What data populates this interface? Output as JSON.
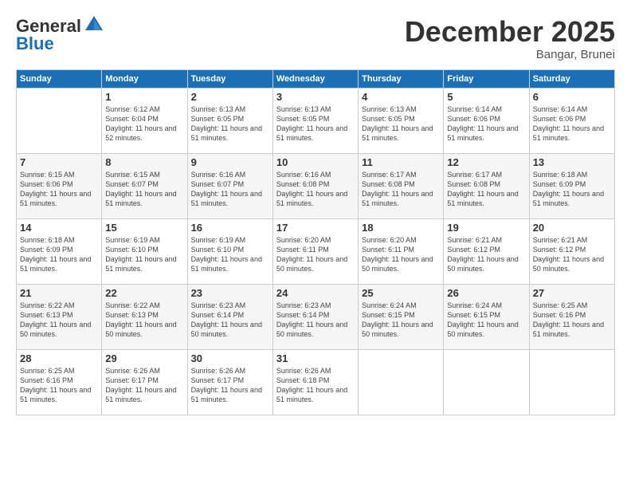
{
  "header": {
    "logo_line1": "General",
    "logo_line2": "Blue",
    "month_title": "December 2025",
    "location": "Bangar, Brunei"
  },
  "weekdays": [
    "Sunday",
    "Monday",
    "Tuesday",
    "Wednesday",
    "Thursday",
    "Friday",
    "Saturday"
  ],
  "weeks": [
    [
      {
        "day": "",
        "sunrise": "",
        "sunset": "",
        "daylight": ""
      },
      {
        "day": "1",
        "sunrise": "Sunrise: 6:12 AM",
        "sunset": "Sunset: 6:04 PM",
        "daylight": "Daylight: 11 hours and 52 minutes."
      },
      {
        "day": "2",
        "sunrise": "Sunrise: 6:13 AM",
        "sunset": "Sunset: 6:05 PM",
        "daylight": "Daylight: 11 hours and 51 minutes."
      },
      {
        "day": "3",
        "sunrise": "Sunrise: 6:13 AM",
        "sunset": "Sunset: 6:05 PM",
        "daylight": "Daylight: 11 hours and 51 minutes."
      },
      {
        "day": "4",
        "sunrise": "Sunrise: 6:13 AM",
        "sunset": "Sunset: 6:05 PM",
        "daylight": "Daylight: 11 hours and 51 minutes."
      },
      {
        "day": "5",
        "sunrise": "Sunrise: 6:14 AM",
        "sunset": "Sunset: 6:06 PM",
        "daylight": "Daylight: 11 hours and 51 minutes."
      },
      {
        "day": "6",
        "sunrise": "Sunrise: 6:14 AM",
        "sunset": "Sunset: 6:06 PM",
        "daylight": "Daylight: 11 hours and 51 minutes."
      }
    ],
    [
      {
        "day": "7",
        "sunrise": "Sunrise: 6:15 AM",
        "sunset": "Sunset: 6:06 PM",
        "daylight": "Daylight: 11 hours and 51 minutes."
      },
      {
        "day": "8",
        "sunrise": "Sunrise: 6:15 AM",
        "sunset": "Sunset: 6:07 PM",
        "daylight": "Daylight: 11 hours and 51 minutes."
      },
      {
        "day": "9",
        "sunrise": "Sunrise: 6:16 AM",
        "sunset": "Sunset: 6:07 PM",
        "daylight": "Daylight: 11 hours and 51 minutes."
      },
      {
        "day": "10",
        "sunrise": "Sunrise: 6:16 AM",
        "sunset": "Sunset: 6:08 PM",
        "daylight": "Daylight: 11 hours and 51 minutes."
      },
      {
        "day": "11",
        "sunrise": "Sunrise: 6:17 AM",
        "sunset": "Sunset: 6:08 PM",
        "daylight": "Daylight: 11 hours and 51 minutes."
      },
      {
        "day": "12",
        "sunrise": "Sunrise: 6:17 AM",
        "sunset": "Sunset: 6:08 PM",
        "daylight": "Daylight: 11 hours and 51 minutes."
      },
      {
        "day": "13",
        "sunrise": "Sunrise: 6:18 AM",
        "sunset": "Sunset: 6:09 PM",
        "daylight": "Daylight: 11 hours and 51 minutes."
      }
    ],
    [
      {
        "day": "14",
        "sunrise": "Sunrise: 6:18 AM",
        "sunset": "Sunset: 6:09 PM",
        "daylight": "Daylight: 11 hours and 51 minutes."
      },
      {
        "day": "15",
        "sunrise": "Sunrise: 6:19 AM",
        "sunset": "Sunset: 6:10 PM",
        "daylight": "Daylight: 11 hours and 51 minutes."
      },
      {
        "day": "16",
        "sunrise": "Sunrise: 6:19 AM",
        "sunset": "Sunset: 6:10 PM",
        "daylight": "Daylight: 11 hours and 51 minutes."
      },
      {
        "day": "17",
        "sunrise": "Sunrise: 6:20 AM",
        "sunset": "Sunset: 6:11 PM",
        "daylight": "Daylight: 11 hours and 50 minutes."
      },
      {
        "day": "18",
        "sunrise": "Sunrise: 6:20 AM",
        "sunset": "Sunset: 6:11 PM",
        "daylight": "Daylight: 11 hours and 50 minutes."
      },
      {
        "day": "19",
        "sunrise": "Sunrise: 6:21 AM",
        "sunset": "Sunset: 6:12 PM",
        "daylight": "Daylight: 11 hours and 50 minutes."
      },
      {
        "day": "20",
        "sunrise": "Sunrise: 6:21 AM",
        "sunset": "Sunset: 6:12 PM",
        "daylight": "Daylight: 11 hours and 50 minutes."
      }
    ],
    [
      {
        "day": "21",
        "sunrise": "Sunrise: 6:22 AM",
        "sunset": "Sunset: 6:13 PM",
        "daylight": "Daylight: 11 hours and 50 minutes."
      },
      {
        "day": "22",
        "sunrise": "Sunrise: 6:22 AM",
        "sunset": "Sunset: 6:13 PM",
        "daylight": "Daylight: 11 hours and 50 minutes."
      },
      {
        "day": "23",
        "sunrise": "Sunrise: 6:23 AM",
        "sunset": "Sunset: 6:14 PM",
        "daylight": "Daylight: 11 hours and 50 minutes."
      },
      {
        "day": "24",
        "sunrise": "Sunrise: 6:23 AM",
        "sunset": "Sunset: 6:14 PM",
        "daylight": "Daylight: 11 hours and 50 minutes."
      },
      {
        "day": "25",
        "sunrise": "Sunrise: 6:24 AM",
        "sunset": "Sunset: 6:15 PM",
        "daylight": "Daylight: 11 hours and 50 minutes."
      },
      {
        "day": "26",
        "sunrise": "Sunrise: 6:24 AM",
        "sunset": "Sunset: 6:15 PM",
        "daylight": "Daylight: 11 hours and 50 minutes."
      },
      {
        "day": "27",
        "sunrise": "Sunrise: 6:25 AM",
        "sunset": "Sunset: 6:16 PM",
        "daylight": "Daylight: 11 hours and 51 minutes."
      }
    ],
    [
      {
        "day": "28",
        "sunrise": "Sunrise: 6:25 AM",
        "sunset": "Sunset: 6:16 PM",
        "daylight": "Daylight: 11 hours and 51 minutes."
      },
      {
        "day": "29",
        "sunrise": "Sunrise: 6:26 AM",
        "sunset": "Sunset: 6:17 PM",
        "daylight": "Daylight: 11 hours and 51 minutes."
      },
      {
        "day": "30",
        "sunrise": "Sunrise: 6:26 AM",
        "sunset": "Sunset: 6:17 PM",
        "daylight": "Daylight: 11 hours and 51 minutes."
      },
      {
        "day": "31",
        "sunrise": "Sunrise: 6:26 AM",
        "sunset": "Sunset: 6:18 PM",
        "daylight": "Daylight: 11 hours and 51 minutes."
      },
      {
        "day": "",
        "sunrise": "",
        "sunset": "",
        "daylight": ""
      },
      {
        "day": "",
        "sunrise": "",
        "sunset": "",
        "daylight": ""
      },
      {
        "day": "",
        "sunrise": "",
        "sunset": "",
        "daylight": ""
      }
    ]
  ]
}
